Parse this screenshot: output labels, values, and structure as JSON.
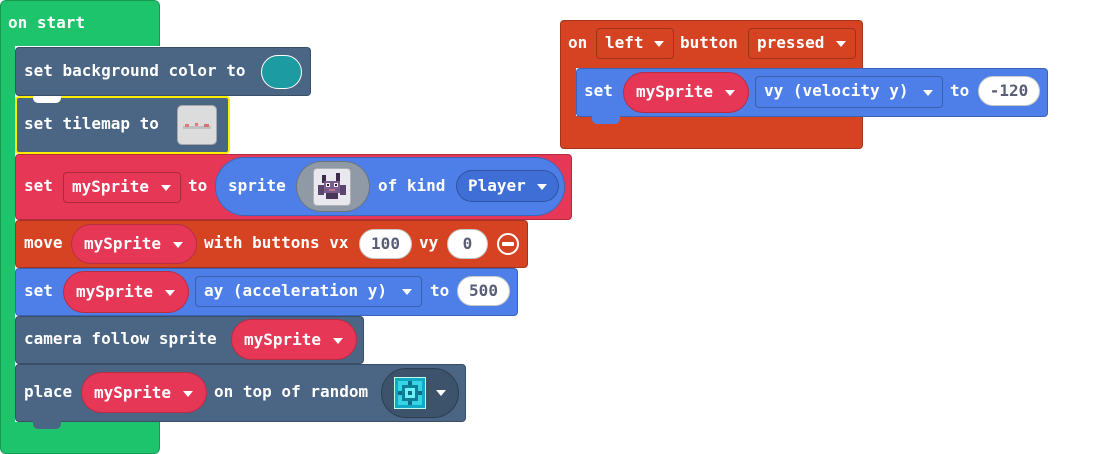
{
  "colors": {
    "events": "#1ec46c",
    "scene": "#4b6584",
    "sprites": "#e63757",
    "sprite_reporter": "#4e7fe8",
    "controller": "#d54322",
    "teal": "#1c9ba3",
    "highlight": "#ffee00"
  },
  "on_start": {
    "label": "on start",
    "blocks": {
      "set_bg": {
        "label": "set background color to"
      },
      "set_tilemap": {
        "label": "set tilemap to"
      },
      "set_sprite": {
        "label_set": "set",
        "var": "mySprite",
        "label_to": "to",
        "sprite_label": "sprite",
        "sprite_icon": "bat-sprite-image",
        "of_kind_label": "of kind",
        "kind": "Player"
      },
      "move": {
        "label_move": "move",
        "var": "mySprite",
        "label_with": "with buttons vx",
        "vx": "100",
        "label_vy": "vy",
        "vy": "0",
        "remove_icon": "minus-circle-icon"
      },
      "set_ay": {
        "label_set": "set",
        "var": "mySprite",
        "property": "ay (acceleration y)",
        "label_to": "to",
        "value": "500"
      },
      "camera": {
        "label": "camera follow sprite",
        "var": "mySprite"
      },
      "place": {
        "label_place": "place",
        "var": "mySprite",
        "label_on_top": "on top of random",
        "tile_icon": "tile-image-icon"
      }
    }
  },
  "on_button": {
    "label_on": "on",
    "button": "left",
    "label_button": "button",
    "event": "pressed",
    "set_vy": {
      "label_set": "set",
      "var": "mySprite",
      "property": "vy (velocity y)",
      "label_to": "to",
      "value": "-120"
    }
  }
}
